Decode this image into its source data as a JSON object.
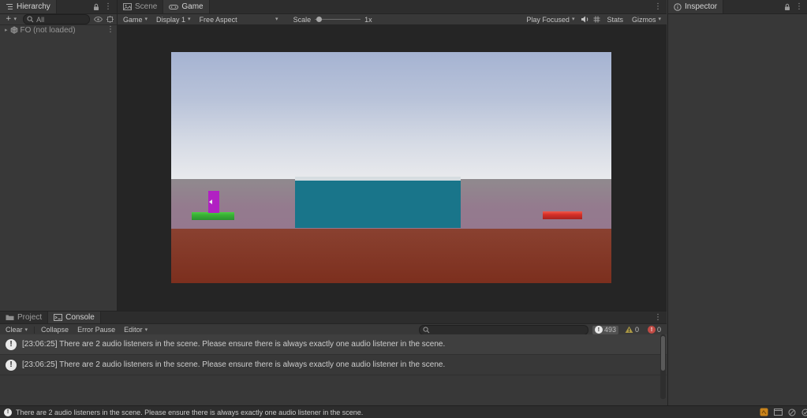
{
  "icons": {
    "kebab": "⋮",
    "caret": "▾",
    "expander": "▸",
    "plus": "+",
    "exclamation": "!"
  },
  "colors": {
    "panel_bg": "#383838",
    "tabbar_bg": "#2d2d2d",
    "viewport_bg": "#252525",
    "active_filter_bg": "#515151",
    "status_bar_bg": "#2d2d2d"
  },
  "hierarchy": {
    "tab_label": "Hierarchy",
    "search_scope": "All",
    "items": [
      {
        "label": "FO (not loaded)"
      }
    ]
  },
  "game_view": {
    "tabs": {
      "scene": "Scene",
      "game": "Game"
    },
    "toolbar": {
      "game_menu": "Game",
      "display_menu": "Display 1",
      "aspect_menu": "Free Aspect",
      "scale_label": "Scale",
      "scale_value": "1x",
      "play_focused_menu": "Play Focused",
      "stats_button": "Stats",
      "gizmos_menu": "Gizmos"
    },
    "scene_render": {
      "sky_gradient_top": "#a5b3d2",
      "sky_gradient_horizon": "#e9eaed",
      "ground_color": "#95788e",
      "floor_front_color": "#7c2f1e",
      "objects": [
        {
          "name": "teal-cube",
          "color": "#19758a"
        },
        {
          "name": "green-platform",
          "color": "#39b335"
        },
        {
          "name": "magenta-box",
          "color": "#b120c3"
        },
        {
          "name": "red-platform",
          "color": "#d63028"
        }
      ]
    }
  },
  "inspector": {
    "tab_label": "Inspector"
  },
  "bottom_panel": {
    "tabs": {
      "project": "Project",
      "console": "Console"
    },
    "toolbar": {
      "clear": "Clear",
      "collapse": "Collapse",
      "error_pause": "Error Pause",
      "editor": "Editor",
      "search_value": ""
    },
    "counts": {
      "info": "493",
      "warnings": "0",
      "errors": "0"
    },
    "entries": [
      {
        "text": "[23:06:25] There are 2 audio listeners in the scene. Please ensure there is always exactly one audio listener in the scene."
      },
      {
        "text": "[23:06:25] There are 2 audio listeners in the scene. Please ensure there is always exactly one audio listener in the scene."
      }
    ]
  },
  "status_bar": {
    "message": "There are 2 audio listeners in the scene. Please ensure there is always exactly one audio listener in the scene."
  }
}
